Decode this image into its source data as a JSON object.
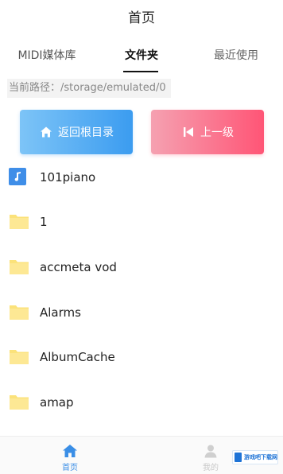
{
  "header": {
    "title": "首页"
  },
  "tabs": [
    {
      "label": "MIDI媒体库",
      "active": false
    },
    {
      "label": "文件夹",
      "active": true
    },
    {
      "label": "最近使用",
      "active": false
    }
  ],
  "path": {
    "text": "当前路径：/storage/emulated/0"
  },
  "buttons": {
    "back_root": {
      "label": "返回根目录",
      "icon": "home-icon"
    },
    "up_level": {
      "label": "上一级",
      "icon": "skip-back-icon"
    }
  },
  "files": [
    {
      "name": "101piano",
      "type": "music"
    },
    {
      "name": "1",
      "type": "folder"
    },
    {
      "name": "accmeta vod",
      "type": "folder"
    },
    {
      "name": "Alarms",
      "type": "folder"
    },
    {
      "name": "AlbumCache",
      "type": "folder"
    },
    {
      "name": "amap",
      "type": "folder"
    }
  ],
  "bottom_nav": [
    {
      "label": "首页",
      "icon": "home-icon",
      "active": true
    },
    {
      "label": "我的",
      "icon": "user-icon",
      "active": false
    }
  ],
  "watermark": {
    "text": "游戏吧下载网"
  },
  "colors": {
    "accent": "#3a8ee6",
    "back_btn": "#3b9cf0",
    "up_btn": "#ff5576",
    "folder": "#fbe27a"
  }
}
